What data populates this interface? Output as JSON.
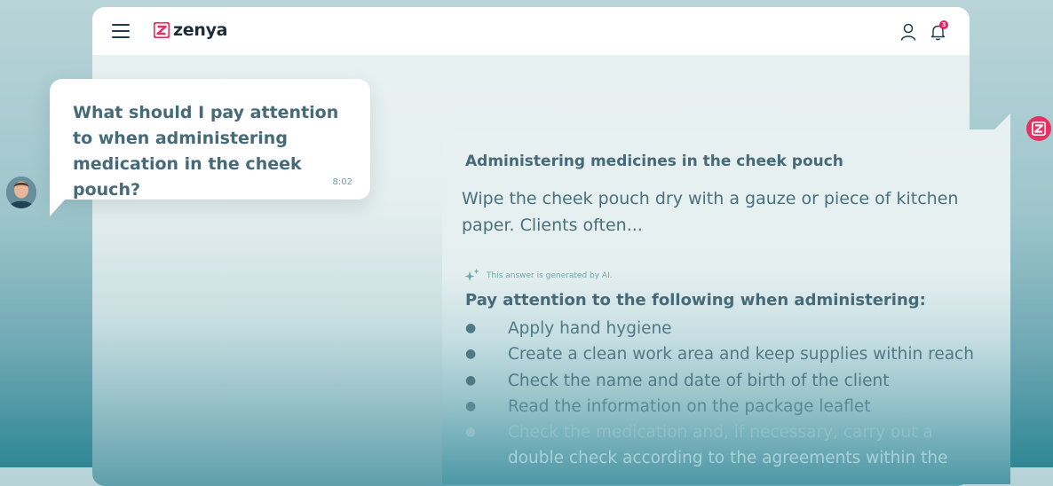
{
  "app": {
    "brand": "zenya",
    "notification_count": "3"
  },
  "question": {
    "text": "What should I pay attention to when administering medication in the cheek pouch?",
    "time": "8:02"
  },
  "answer": {
    "title": "Administering medicines in the cheek pouch",
    "snippet": "Wipe the cheek pouch dry with a gauze or piece of kitchen paper. Clients often...",
    "ai_note": "This answer is generated by AI.",
    "list_heading": "Pay attention to the following when administering:",
    "items": [
      "Apply hand hygiene",
      "Create a clean work area and keep supplies within reach",
      "Check the name and date of birth of the client",
      "Read the information on the package leaflet",
      "Check the medication and, if necessary, carry out a",
      "double check according to the agreements within the"
    ]
  },
  "colors": {
    "brand_accent": "#e63163",
    "text_primary": "#466a78",
    "badge": "#e5245b"
  },
  "icons": [
    "menu-icon",
    "zenya-logo-icon",
    "user-icon",
    "bell-icon",
    "sparkle-icon"
  ]
}
